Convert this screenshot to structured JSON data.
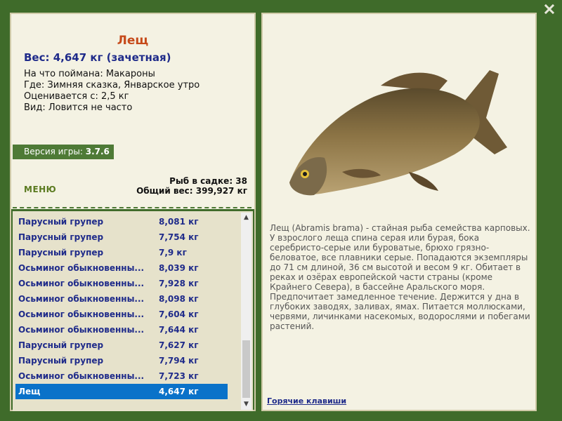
{
  "catch": {
    "name": "Лещ",
    "weight_line": "Вес: 4,647 кг (зачетная)",
    "caught_on": "На что поймана: Макароны",
    "where": "Где: Зимняя сказка, Январское утро",
    "valued_from": "Оценивается с: 2,5 кг",
    "kind": "Вид: Ловится не часто"
  },
  "version": {
    "label": "Версия игры:",
    "value": "3.7.6"
  },
  "menu_label": "МЕНЮ",
  "stats": {
    "keep_count": "Рыб в садке: 38",
    "total_weight": "Общий вес: 399,927 кг"
  },
  "fish_list": [
    {
      "name": "Парусный групер",
      "weight": "8,081 кг"
    },
    {
      "name": "Парусный групер",
      "weight": "7,754 кг"
    },
    {
      "name": "Парусный групер",
      "weight": "7,9 кг"
    },
    {
      "name": "Осьминог обыкновенны...",
      "weight": "8,039 кг"
    },
    {
      "name": "Осьминог обыкновенны...",
      "weight": "7,928 кг"
    },
    {
      "name": "Осьминог обыкновенны...",
      "weight": "8,098 кг"
    },
    {
      "name": "Осьминог обыкновенны...",
      "weight": "7,604 кг"
    },
    {
      "name": "Осьминог обыкновенны...",
      "weight": "7,644 кг"
    },
    {
      "name": "Парусный групер",
      "weight": "7,627 кг"
    },
    {
      "name": "Парусный групер",
      "weight": "7,794 кг"
    },
    {
      "name": "Осьминог обыкновенны...",
      "weight": "7,723 кг"
    },
    {
      "name": "Лещ",
      "weight": "4,647 кг",
      "selected": true
    }
  ],
  "description": "Лещ (Abramis brama) - стайная рыба семейства карповых. У взрослого леща спина серая или бурая, бока серебристо-серые или буроватые, брюхо грязно-беловатое, все плавники серые. Попадаются экземпляры до 71 см длиной, 36 см высотой и весом 9 кг. Обитает в реках и озёрах европейской части страны (кроме Крайнего Севера), в бассейне Аральского моря. Предпочитает замедленное течение. Держится у дна в глубоких заводях, заливах, ямах. Питается моллюсками, червями, личинками насекомых, водорослями и побегами растений.",
  "hotkeys_label": "Горячие клавиши",
  "icons": {
    "close": "close-icon",
    "scroll_up": "arrow-up-icon",
    "scroll_down": "arrow-down-icon"
  },
  "colors": {
    "background": "#3f6b2a",
    "panel": "#f4f2e3",
    "list": "#e6e2cb",
    "title": "#c64a1a",
    "list_text": "#1f2b8a",
    "selection": "#0a72c9"
  }
}
